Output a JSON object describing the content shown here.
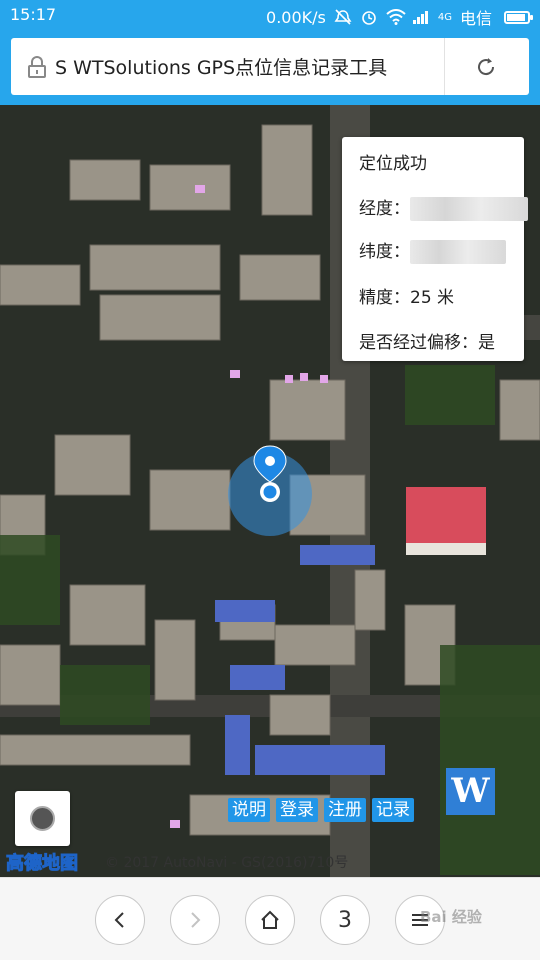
{
  "status_bar": {
    "time": "15:17",
    "net_speed": "0.00K/s",
    "network_type": "4G",
    "carrier": "电信",
    "battery_level_percent": 90,
    "icons": [
      "mute-icon",
      "alarm-icon",
      "wifi-icon",
      "signal-icon",
      "battery-icon"
    ]
  },
  "browser": {
    "page_title": "S WTSolutions GPS点位信息记录工具",
    "icons": [
      "lock-icon",
      "reload-icon"
    ],
    "accent_color": "#27a6ec"
  },
  "location_popup": {
    "status": "定位成功",
    "longitude_label": "经度：",
    "latitude_label": "纬度：",
    "accuracy_label": "精度：",
    "accuracy_value": "25 米",
    "offset_label": "是否经过偏移：",
    "offset_value": "是"
  },
  "map": {
    "actions": [
      "说明",
      "登录",
      "注册",
      "记录"
    ],
    "logo_letter": "W",
    "provider_logo": "高德地图",
    "copyright": "© 2017 AutoNavi - GS(2016)710号",
    "action_color": "#2196e8"
  },
  "bottom_nav": {
    "tab_count": "3",
    "icons": [
      "back-icon",
      "forward-icon",
      "home-icon",
      "tabs-counter",
      "menu-icon"
    ]
  },
  "watermark": "Bai 经验"
}
